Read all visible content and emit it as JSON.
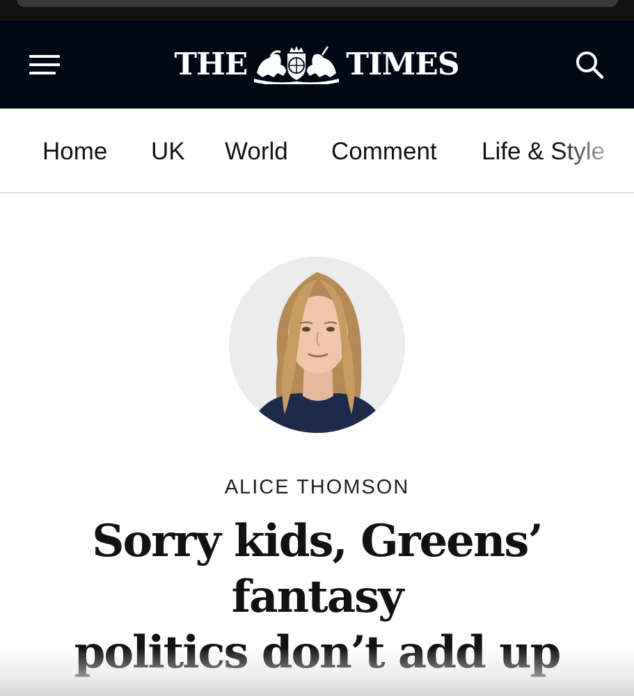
{
  "masthead": {
    "logo_left": "THE",
    "logo_right": "TIMES",
    "crest_icon": "royal-coat-of-arms-icon",
    "menu_icon": "hamburger-menu-icon",
    "search_icon": "search-icon",
    "background_color": "#000814"
  },
  "nav": {
    "items": [
      {
        "label": "Home"
      },
      {
        "label": "UK"
      },
      {
        "label": "World"
      },
      {
        "label": "Comment"
      },
      {
        "label": "Life & Style"
      }
    ]
  },
  "article": {
    "author": "ALICE THOMSON",
    "headline_line1": "Sorry kids, Greens’ fantasy",
    "headline_line2": "politics don’t add up"
  }
}
